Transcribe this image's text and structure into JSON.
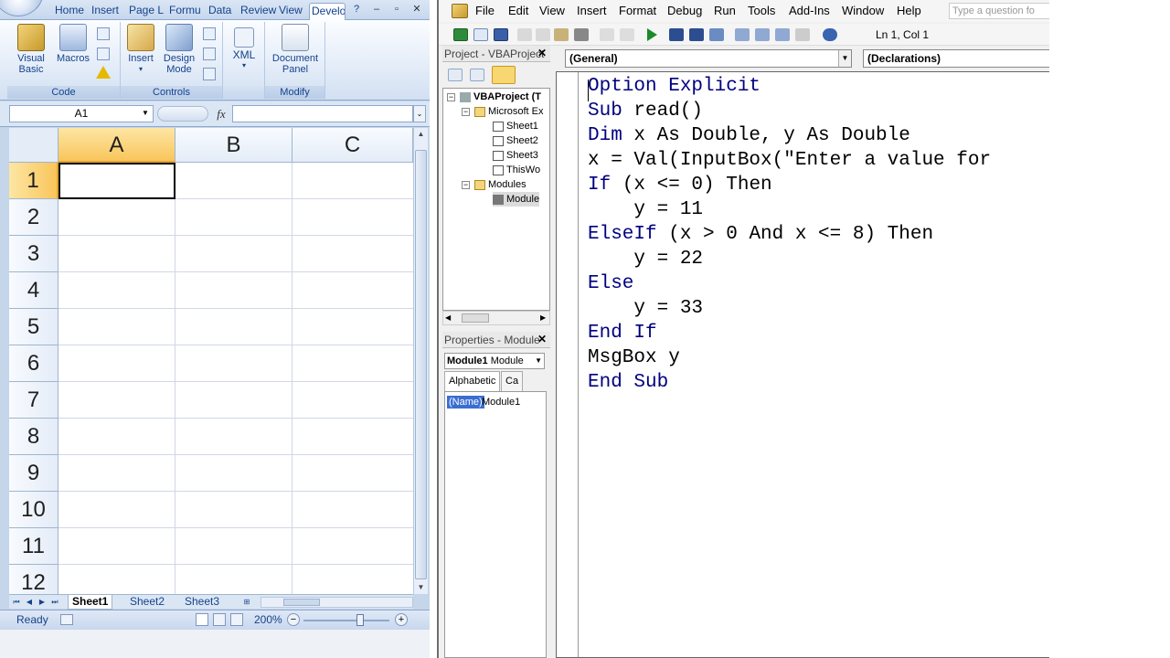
{
  "excel": {
    "tabs": [
      "Home",
      "Insert",
      "Page L",
      "Formu",
      "Data",
      "Review",
      "View",
      "Develo"
    ],
    "ribbon": {
      "code_group": {
        "label": "Code",
        "visual_basic": "Visual Basic",
        "visual_basic_line1": "Visual",
        "visual_basic_line2": "Basic",
        "macros": "Macros"
      },
      "controls_group": {
        "label": "Controls",
        "insert": "Insert",
        "design_mode_line1": "Design",
        "design_mode_line2": "Mode"
      },
      "xml_group": {
        "xml": "XML"
      },
      "modify_group": {
        "label": "Modify",
        "document_panel_line1": "Document",
        "document_panel_line2": "Panel"
      }
    },
    "name_box": "A1",
    "fx_label": "fx",
    "columns": [
      "A",
      "B",
      "C"
    ],
    "rows": [
      "1",
      "2",
      "3",
      "4",
      "5",
      "6",
      "7",
      "8",
      "9",
      "10",
      "11",
      "12"
    ],
    "sheets": [
      "Sheet1",
      "Sheet2",
      "Sheet3"
    ],
    "active_sheet": "Sheet1",
    "status": "Ready",
    "zoom": "200%"
  },
  "vbe": {
    "menu": [
      "File",
      "Edit",
      "View",
      "Insert",
      "Format",
      "Debug",
      "Run",
      "Tools",
      "Add-Ins",
      "Window",
      "Help"
    ],
    "ask_placeholder": "Type a question fo",
    "cursor_position": "Ln 1, Col 1",
    "project": {
      "title": "Project - VBAProject",
      "root": "VBAProject (T",
      "ms_objects": "Microsoft Ex",
      "items": [
        "Sheet1",
        "Sheet2",
        "Sheet3",
        "ThisWo"
      ],
      "modules_folder": "Modules",
      "module": "Module"
    },
    "properties": {
      "title": "Properties - Module",
      "combo_bold": "Module1",
      "combo_rest": "Module",
      "tab_alpha": "Alphabetic",
      "tab_cat": "Ca",
      "name_key": "(Name)",
      "name_value": "Module1"
    },
    "object_combo": "(General)",
    "proc_combo": "(Declarations)",
    "code": [
      {
        "kw": "Option Explicit",
        "rest": ""
      },
      {
        "kw": "Sub",
        "rest": " read()"
      },
      {
        "kw": "Dim",
        "rest": " x As Double, y As Double"
      },
      {
        "kw": "",
        "rest": "x = Val(InputBox(\"Enter a value for"
      },
      {
        "kw": "If",
        "rest": " (x <= 0) Then"
      },
      {
        "kw": "",
        "rest": "    y = 11"
      },
      {
        "kw": "ElseIf",
        "rest": " (x > 0 And x <= 8) Then"
      },
      {
        "kw": "",
        "rest": "    y = 22"
      },
      {
        "kw": "Else",
        "rest": ""
      },
      {
        "kw": "",
        "rest": "    y = 33"
      },
      {
        "kw": "End If",
        "rest": ""
      },
      {
        "kw": "",
        "rest": "MsgBox y"
      },
      {
        "kw": "End Sub",
        "rest": ""
      }
    ]
  }
}
